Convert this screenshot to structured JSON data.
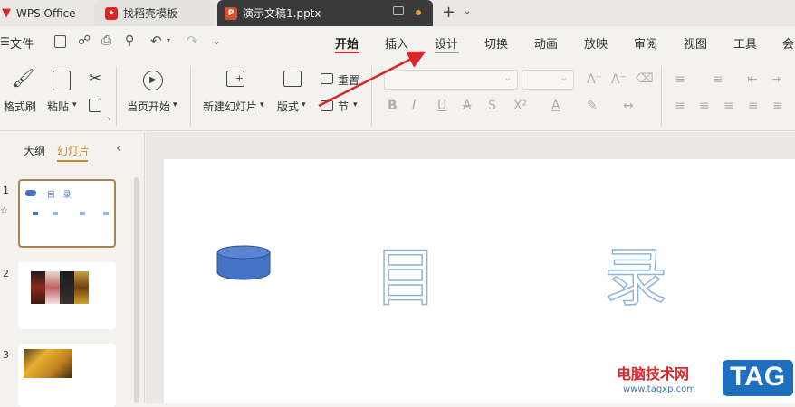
{
  "tabs": [
    {
      "label": "WPS Office",
      "icon": "wps-logo-icon"
    },
    {
      "label": "找稻壳模板",
      "icon": "docer-icon"
    },
    {
      "label": "演示文稿1.pptx",
      "icon": "ppt-icon"
    }
  ],
  "menu": {
    "file": "文件",
    "tabs": [
      "开始",
      "插入",
      "设计",
      "切换",
      "动画",
      "放映",
      "审阅",
      "视图",
      "工具",
      "会"
    ],
    "active": "开始"
  },
  "ribbon": {
    "format_painter": "格式刷",
    "paste": "粘贴",
    "play_from_current": "当页开始",
    "new_slide": "新建幻灯片",
    "layout": "版式",
    "reset": "重置",
    "section": "节"
  },
  "panel": {
    "outline_tab": "大纲",
    "slides_tab": "幻灯片",
    "slide_numbers": [
      "1",
      "2",
      "3"
    ],
    "thumb1_title": "目   录"
  },
  "slide": {
    "char1": "目",
    "char2": "录"
  },
  "watermark": {
    "site_name": "电脑技术网",
    "url": "www.tagxp.com",
    "tag": "TAG"
  },
  "colors": {
    "accent_red": "#d9262b",
    "shape_blue": "#4472c4",
    "tag_blue": "#1f6fbf"
  }
}
